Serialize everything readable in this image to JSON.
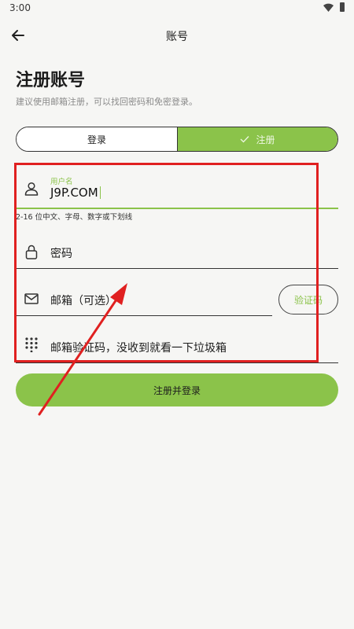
{
  "status": {
    "time": "3:00"
  },
  "appbar": {
    "title": "账号"
  },
  "page": {
    "title": "注册账号",
    "subtitle": "建议使用邮箱注册，可以找回密码和免密登录。"
  },
  "tabs": {
    "login_label": "登录",
    "register_label": "注册",
    "selected": "注册"
  },
  "form": {
    "username": {
      "label": "用户名",
      "value": "J9P.COM",
      "hint": "2-16 位中文、字母、数字或下划线"
    },
    "password": {
      "placeholder": "密码"
    },
    "email": {
      "placeholder": "邮箱（可选）"
    },
    "email_code": {
      "placeholder": "邮箱验证码，没收到就看一下垃圾箱"
    },
    "code_button_label": "验证码"
  },
  "submit_label": "注册并登录",
  "colors": {
    "accent": "#8bc34a",
    "annotation": "#e02020",
    "background": "#f6f6f4"
  },
  "icons": [
    "back-arrow-icon",
    "person-icon",
    "lock-icon",
    "mail-icon",
    "keypad-icon",
    "check-icon",
    "wifi-icon",
    "battery-icon"
  ]
}
